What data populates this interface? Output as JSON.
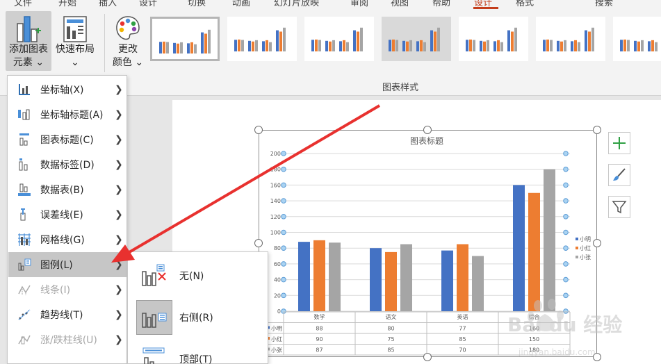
{
  "ribbon": {
    "add_element": {
      "line1": "添加图表",
      "line2": "元素",
      "caret": "⌄"
    },
    "quick_layout": {
      "line1": "快速布局",
      "caret": "⌄"
    },
    "change_color": {
      "line1": "更改",
      "line2": "颜色",
      "caret": "⌄"
    },
    "styles_group_label": "图表样式"
  },
  "menu": {
    "items": [
      {
        "label": "坐标轴(X)",
        "key": "axes",
        "icon": "axes-icon",
        "highlighted": false,
        "disabled": false
      },
      {
        "label": "坐标轴标题(A)",
        "key": "axis-titles",
        "icon": "axis-titles-icon",
        "highlighted": false,
        "disabled": false
      },
      {
        "label": "图表标题(C)",
        "key": "chart-title",
        "icon": "chart-title-icon",
        "highlighted": false,
        "disabled": false
      },
      {
        "label": "数据标签(D)",
        "key": "data-labels",
        "icon": "data-labels-icon",
        "highlighted": false,
        "disabled": false
      },
      {
        "label": "数据表(B)",
        "key": "data-table",
        "icon": "data-table-icon",
        "highlighted": false,
        "disabled": false
      },
      {
        "label": "误差线(E)",
        "key": "error-bars",
        "icon": "error-bars-icon",
        "highlighted": false,
        "disabled": false
      },
      {
        "label": "网格线(G)",
        "key": "gridlines",
        "icon": "gridlines-icon",
        "highlighted": false,
        "disabled": false
      },
      {
        "label": "图例(L)",
        "key": "legend",
        "icon": "legend-icon",
        "highlighted": true,
        "disabled": false
      },
      {
        "label": "线条(I)",
        "key": "lines",
        "icon": "lines-icon",
        "highlighted": false,
        "disabled": true
      },
      {
        "label": "趋势线(T)",
        "key": "trendline",
        "icon": "trendline-icon",
        "highlighted": false,
        "disabled": false
      },
      {
        "label": "涨/跌柱线(U)",
        "key": "up-down-bars",
        "icon": "up-down-bars-icon",
        "highlighted": false,
        "disabled": true
      }
    ]
  },
  "submenu": {
    "items": [
      {
        "label": "无(N)",
        "key": "none",
        "selected": false
      },
      {
        "label": "右侧(R)",
        "key": "right",
        "selected": true
      },
      {
        "label": "顶部(T)",
        "key": "top",
        "selected": false
      }
    ]
  },
  "colors": {
    "accent": "#c43e1c",
    "series_1": "#4472c4",
    "series_2": "#ed7d31",
    "series_3": "#a5a5a5",
    "handle": "#5b9bd5",
    "arrow": "#e8312f",
    "plus_green": "#2ea043"
  },
  "chart_data": {
    "type": "bar",
    "title": "图表标题",
    "categories": [
      "数学",
      "语文",
      "英语",
      "综合"
    ],
    "series": [
      {
        "name": "小明",
        "values": [
          88,
          80,
          77,
          160
        ]
      },
      {
        "name": "小红",
        "values": [
          90,
          75,
          85,
          150
        ]
      },
      {
        "name": "小张",
        "values": [
          87,
          85,
          70,
          180
        ]
      }
    ],
    "y_ticks": [
      0,
      20,
      40,
      60,
      80,
      100,
      120,
      140,
      160,
      180,
      200
    ],
    "ylim": [
      0,
      200
    ],
    "grid": true,
    "legend": "right",
    "data_table": true
  },
  "watermark": {
    "brand": "Bai du 经验",
    "url": "jingyan.baidu.com"
  }
}
